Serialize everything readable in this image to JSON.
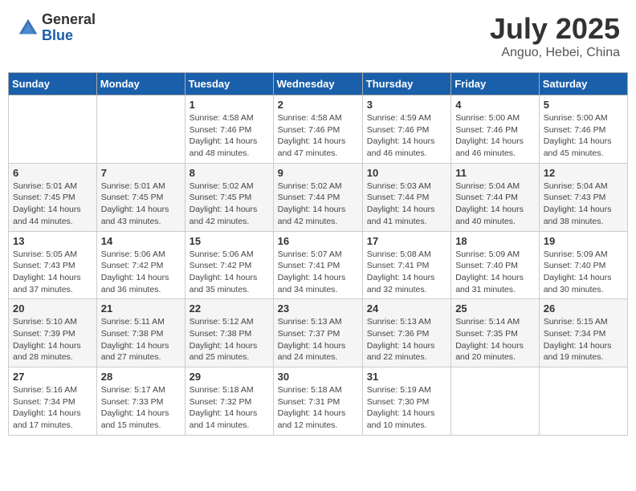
{
  "header": {
    "logo_general": "General",
    "logo_blue": "Blue",
    "month_title": "July 2025",
    "location": "Anguo, Hebei, China"
  },
  "weekdays": [
    "Sunday",
    "Monday",
    "Tuesday",
    "Wednesday",
    "Thursday",
    "Friday",
    "Saturday"
  ],
  "weeks": [
    [
      {
        "day": "",
        "info": ""
      },
      {
        "day": "",
        "info": ""
      },
      {
        "day": "1",
        "info": "Sunrise: 4:58 AM\nSunset: 7:46 PM\nDaylight: 14 hours and 48 minutes."
      },
      {
        "day": "2",
        "info": "Sunrise: 4:58 AM\nSunset: 7:46 PM\nDaylight: 14 hours and 47 minutes."
      },
      {
        "day": "3",
        "info": "Sunrise: 4:59 AM\nSunset: 7:46 PM\nDaylight: 14 hours and 46 minutes."
      },
      {
        "day": "4",
        "info": "Sunrise: 5:00 AM\nSunset: 7:46 PM\nDaylight: 14 hours and 46 minutes."
      },
      {
        "day": "5",
        "info": "Sunrise: 5:00 AM\nSunset: 7:46 PM\nDaylight: 14 hours and 45 minutes."
      }
    ],
    [
      {
        "day": "6",
        "info": "Sunrise: 5:01 AM\nSunset: 7:45 PM\nDaylight: 14 hours and 44 minutes."
      },
      {
        "day": "7",
        "info": "Sunrise: 5:01 AM\nSunset: 7:45 PM\nDaylight: 14 hours and 43 minutes."
      },
      {
        "day": "8",
        "info": "Sunrise: 5:02 AM\nSunset: 7:45 PM\nDaylight: 14 hours and 42 minutes."
      },
      {
        "day": "9",
        "info": "Sunrise: 5:02 AM\nSunset: 7:44 PM\nDaylight: 14 hours and 42 minutes."
      },
      {
        "day": "10",
        "info": "Sunrise: 5:03 AM\nSunset: 7:44 PM\nDaylight: 14 hours and 41 minutes."
      },
      {
        "day": "11",
        "info": "Sunrise: 5:04 AM\nSunset: 7:44 PM\nDaylight: 14 hours and 40 minutes."
      },
      {
        "day": "12",
        "info": "Sunrise: 5:04 AM\nSunset: 7:43 PM\nDaylight: 14 hours and 38 minutes."
      }
    ],
    [
      {
        "day": "13",
        "info": "Sunrise: 5:05 AM\nSunset: 7:43 PM\nDaylight: 14 hours and 37 minutes."
      },
      {
        "day": "14",
        "info": "Sunrise: 5:06 AM\nSunset: 7:42 PM\nDaylight: 14 hours and 36 minutes."
      },
      {
        "day": "15",
        "info": "Sunrise: 5:06 AM\nSunset: 7:42 PM\nDaylight: 14 hours and 35 minutes."
      },
      {
        "day": "16",
        "info": "Sunrise: 5:07 AM\nSunset: 7:41 PM\nDaylight: 14 hours and 34 minutes."
      },
      {
        "day": "17",
        "info": "Sunrise: 5:08 AM\nSunset: 7:41 PM\nDaylight: 14 hours and 32 minutes."
      },
      {
        "day": "18",
        "info": "Sunrise: 5:09 AM\nSunset: 7:40 PM\nDaylight: 14 hours and 31 minutes."
      },
      {
        "day": "19",
        "info": "Sunrise: 5:09 AM\nSunset: 7:40 PM\nDaylight: 14 hours and 30 minutes."
      }
    ],
    [
      {
        "day": "20",
        "info": "Sunrise: 5:10 AM\nSunset: 7:39 PM\nDaylight: 14 hours and 28 minutes."
      },
      {
        "day": "21",
        "info": "Sunrise: 5:11 AM\nSunset: 7:38 PM\nDaylight: 14 hours and 27 minutes."
      },
      {
        "day": "22",
        "info": "Sunrise: 5:12 AM\nSunset: 7:38 PM\nDaylight: 14 hours and 25 minutes."
      },
      {
        "day": "23",
        "info": "Sunrise: 5:13 AM\nSunset: 7:37 PM\nDaylight: 14 hours and 24 minutes."
      },
      {
        "day": "24",
        "info": "Sunrise: 5:13 AM\nSunset: 7:36 PM\nDaylight: 14 hours and 22 minutes."
      },
      {
        "day": "25",
        "info": "Sunrise: 5:14 AM\nSunset: 7:35 PM\nDaylight: 14 hours and 20 minutes."
      },
      {
        "day": "26",
        "info": "Sunrise: 5:15 AM\nSunset: 7:34 PM\nDaylight: 14 hours and 19 minutes."
      }
    ],
    [
      {
        "day": "27",
        "info": "Sunrise: 5:16 AM\nSunset: 7:34 PM\nDaylight: 14 hours and 17 minutes."
      },
      {
        "day": "28",
        "info": "Sunrise: 5:17 AM\nSunset: 7:33 PM\nDaylight: 14 hours and 15 minutes."
      },
      {
        "day": "29",
        "info": "Sunrise: 5:18 AM\nSunset: 7:32 PM\nDaylight: 14 hours and 14 minutes."
      },
      {
        "day": "30",
        "info": "Sunrise: 5:18 AM\nSunset: 7:31 PM\nDaylight: 14 hours and 12 minutes."
      },
      {
        "day": "31",
        "info": "Sunrise: 5:19 AM\nSunset: 7:30 PM\nDaylight: 14 hours and 10 minutes."
      },
      {
        "day": "",
        "info": ""
      },
      {
        "day": "",
        "info": ""
      }
    ]
  ]
}
